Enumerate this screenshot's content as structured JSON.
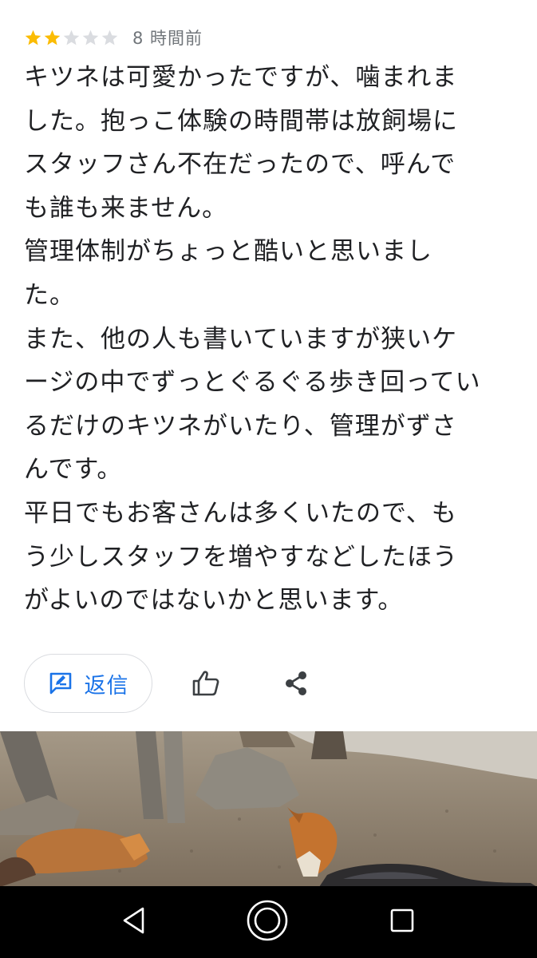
{
  "review": {
    "rating": 2,
    "rating_max": 5,
    "star_colors": {
      "filled": "#fbbc04",
      "empty": "#dadce0"
    },
    "time_ago": "8 時間前",
    "text_lines": [
      "キツネは可愛かったですが、噛まれま",
      "した。抱っこ体験の時間帯は放飼場に",
      "スタッフさん不在だったので、呼んで",
      "も誰も来ません。",
      "管理体制がちょっと酷いと思いまし",
      "た。",
      "また、他の人も書いていますが狭いケ",
      "ージの中でずっとぐるぐる歩き回ってい",
      "るだけのキツネがいたり、管理がずさ",
      "んです。",
      "平日でもお客さんは多くいたので、も",
      "う少しスタッフを増やすなどしたほう",
      "がよいのではないかと思います。"
    ]
  },
  "actions": {
    "reply_label": "返信",
    "reply_icon": "reply-edit-icon",
    "like_icon": "thumbs-up-icon",
    "share_icon": "share-icon",
    "accent_color": "#1a73e8"
  },
  "photo": {
    "subject": "foxes-in-enclosure"
  },
  "nav_bar": {
    "back_icon": "back-triangle-icon",
    "home_icon": "home-circle-icon",
    "recents_icon": "recents-square-icon"
  }
}
